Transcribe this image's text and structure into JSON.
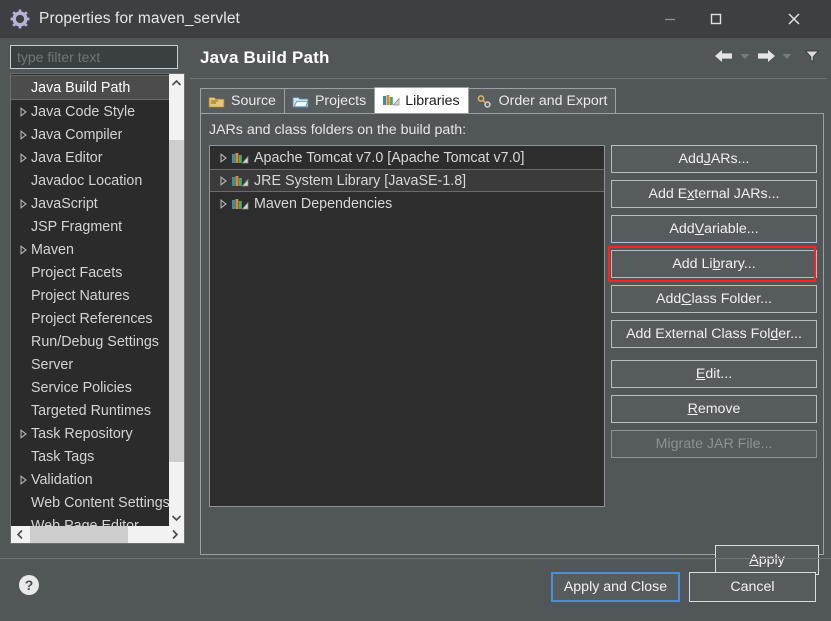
{
  "window": {
    "title": "Properties for maven_servlet",
    "icon": "gear-icon",
    "controls": {
      "minimize": "—",
      "maximize": "☐",
      "close": "✕"
    }
  },
  "sidebar": {
    "filter": {
      "value": "",
      "placeholder": "type filter text"
    },
    "items": [
      {
        "label": "Java Build Path",
        "expandable": false,
        "selected": true
      },
      {
        "label": "Java Code Style",
        "expandable": true,
        "selected": false
      },
      {
        "label": "Java Compiler",
        "expandable": true,
        "selected": false
      },
      {
        "label": "Java Editor",
        "expandable": true,
        "selected": false
      },
      {
        "label": "Javadoc Location",
        "expandable": false,
        "selected": false
      },
      {
        "label": "JavaScript",
        "expandable": true,
        "selected": false
      },
      {
        "label": "JSP Fragment",
        "expandable": false,
        "selected": false
      },
      {
        "label": "Maven",
        "expandable": true,
        "selected": false
      },
      {
        "label": "Project Facets",
        "expandable": false,
        "selected": false
      },
      {
        "label": "Project Natures",
        "expandable": false,
        "selected": false
      },
      {
        "label": "Project References",
        "expandable": false,
        "selected": false
      },
      {
        "label": "Run/Debug Settings",
        "expandable": false,
        "selected": false
      },
      {
        "label": "Server",
        "expandable": false,
        "selected": false
      },
      {
        "label": "Service Policies",
        "expandable": false,
        "selected": false
      },
      {
        "label": "Targeted Runtimes",
        "expandable": false,
        "selected": false
      },
      {
        "label": "Task Repository",
        "expandable": true,
        "selected": false
      },
      {
        "label": "Task Tags",
        "expandable": false,
        "selected": false
      },
      {
        "label": "Validation",
        "expandable": true,
        "selected": false
      },
      {
        "label": "Web Content Settings",
        "expandable": false,
        "selected": false
      },
      {
        "label": "Web Page Editor",
        "expandable": false,
        "selected": false
      }
    ]
  },
  "page": {
    "title": "Java Build Path",
    "nav": {
      "back": "back-arrow-icon",
      "back_menu": "chevron-down-icon",
      "forward": "forward-arrow-icon",
      "forward_menu": "chevron-down-icon",
      "filter_menu": "funnel-icon"
    }
  },
  "tabs": [
    {
      "label": "Source",
      "icon": "source-folder-icon",
      "active": false
    },
    {
      "label": "Projects",
      "icon": "projects-folder-icon",
      "active": false
    },
    {
      "label": "Libraries",
      "icon": "library-books-icon",
      "active": true
    },
    {
      "label": "Order and Export",
      "icon": "order-export-icon",
      "active": false
    }
  ],
  "libraries_tab": {
    "caption": "JARs and class folders on the build path:",
    "entries": [
      {
        "label": "Apache Tomcat v7.0 [Apache Tomcat v7.0]",
        "icon": "library-books-icon",
        "selected": false
      },
      {
        "label": "JRE System Library [JavaSE-1.8]",
        "icon": "library-books-icon",
        "selected": true
      },
      {
        "label": "Maven Dependencies",
        "icon": "library-books-icon",
        "selected": false
      }
    ],
    "buttons": [
      {
        "pre": "Add ",
        "mnemonic": "J",
        "post": "ARs...",
        "enabled": true,
        "highlighted": false
      },
      {
        "pre": "Add E",
        "mnemonic": "x",
        "post": "ternal JARs...",
        "enabled": true,
        "highlighted": false
      },
      {
        "pre": "Add ",
        "mnemonic": "V",
        "post": "ariable...",
        "enabled": true,
        "highlighted": false
      },
      {
        "pre": "Add Li",
        "mnemonic": "b",
        "post": "rary...",
        "enabled": true,
        "highlighted": true
      },
      {
        "pre": "Add ",
        "mnemonic": "C",
        "post": "lass Folder...",
        "enabled": true,
        "highlighted": false
      },
      {
        "pre": "Add External Class Fol",
        "mnemonic": "d",
        "post": "er...",
        "enabled": true,
        "highlighted": false
      },
      {
        "pre": "",
        "mnemonic": "E",
        "post": "dit...",
        "enabled": true,
        "highlighted": false
      },
      {
        "pre": "",
        "mnemonic": "R",
        "post": "emove",
        "enabled": true,
        "highlighted": false
      },
      {
        "pre": "Migrate JAR File...",
        "mnemonic": "",
        "post": "",
        "enabled": false,
        "highlighted": false
      }
    ],
    "apply": {
      "pre": "",
      "mnemonic": "A",
      "post": "pply"
    }
  },
  "footer": {
    "help": "help-icon",
    "apply_and_close": "Apply and Close",
    "cancel": "Cancel"
  },
  "colors": {
    "dialog_bg": "#515659",
    "titlebar_bg": "#3c4043",
    "list_bg": "#2d2d2d",
    "tree_bg": "#2b2b2b",
    "highlight_red": "#ff2020",
    "focus_blue": "#4a90d9",
    "text": "#e8e8e8"
  }
}
